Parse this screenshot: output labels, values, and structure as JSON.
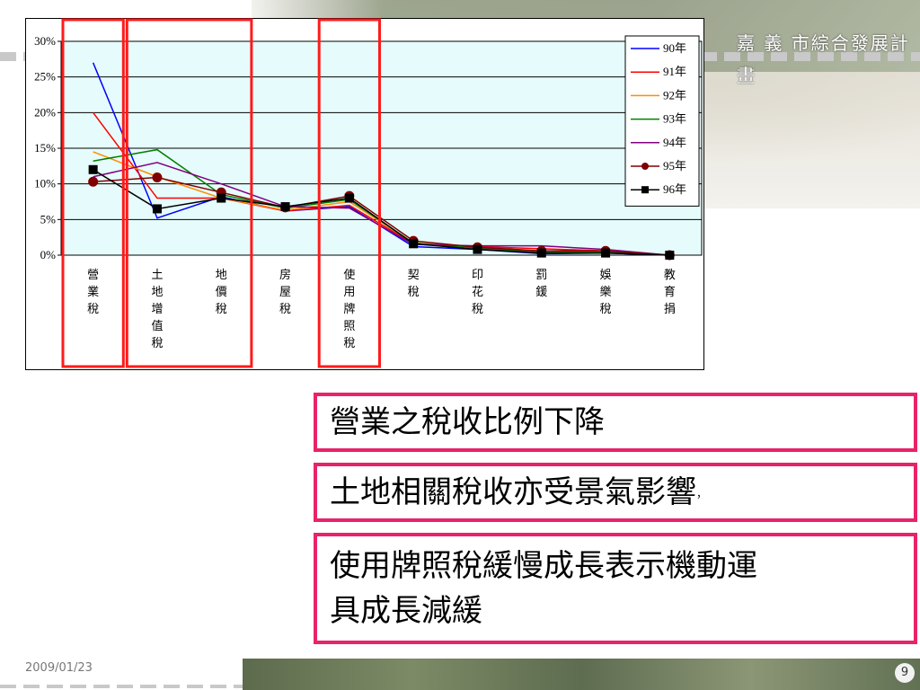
{
  "brand": {
    "title": "嘉 義 市綜合發展計畫"
  },
  "footer": {
    "date": "2009/01/23",
    "page": "9"
  },
  "callouts": {
    "c1": "營業之稅收比例下降",
    "c2": "土地相關稅收亦受景氣影響",
    "c2_tail": "，",
    "c3_line1": "使用牌照稅緩慢成長表示機動運",
    "c3_line2": "具成長減緩"
  },
  "colors": {
    "highlight": "#ff1a1a",
    "callout_border": "#e8236a",
    "plot_bg": "#e6fbfb"
  },
  "chart_data": {
    "type": "line",
    "categories": [
      [
        "營",
        "業",
        "稅"
      ],
      [
        "土",
        "地",
        "增",
        "值",
        "稅"
      ],
      [
        "地",
        "價",
        "稅"
      ],
      [
        "房",
        "屋",
        "稅"
      ],
      [
        "使",
        "用",
        "牌",
        "照",
        "稅"
      ],
      [
        "契",
        "稅"
      ],
      [
        "印",
        "花",
        "稅"
      ],
      [
        "罰",
        "鍰"
      ],
      [
        "娛",
        "樂",
        "稅"
      ],
      [
        "教",
        "育",
        "捐"
      ]
    ],
    "y_ticks": [
      "0%",
      "5%",
      "10%",
      "15%",
      "20%",
      "25%",
      "30%"
    ],
    "ylim": [
      0,
      30
    ],
    "grid": true,
    "legend_position": "top-right",
    "series": [
      {
        "name": "90年",
        "color": "#0000ff",
        "marker": "none",
        "values": [
          27,
          5.2,
          8.2,
          6.2,
          6.8,
          1.2,
          0.8,
          0.2,
          0.3,
          0
        ]
      },
      {
        "name": "91年",
        "color": "#ff0000",
        "marker": "none",
        "values": [
          20,
          8,
          8,
          6.2,
          7,
          1.6,
          1.2,
          0.9,
          0.6,
          0
        ]
      },
      {
        "name": "92年",
        "color": "#ff8c00",
        "marker": "none",
        "values": [
          14.5,
          11,
          8,
          6.3,
          7.5,
          1.7,
          1.1,
          0.5,
          0.5,
          0
        ]
      },
      {
        "name": "93年",
        "color": "#008000",
        "marker": "none",
        "values": [
          13.2,
          14.8,
          8.5,
          6.6,
          7.8,
          1.7,
          1,
          0.4,
          0.4,
          0
        ]
      },
      {
        "name": "94年",
        "color": "#800080",
        "marker": "none",
        "values": [
          11,
          13,
          10,
          6.8,
          6.6,
          1.5,
          1.3,
          1.3,
          0.8,
          0
        ]
      },
      {
        "name": "95年",
        "color": "#800000",
        "marker": "circle",
        "values": [
          10.3,
          10.9,
          8.8,
          6.7,
          8.3,
          2,
          1.1,
          0.6,
          0.6,
          0
        ]
      },
      {
        "name": "96年",
        "color": "#000000",
        "marker": "square",
        "values": [
          12,
          6.5,
          8,
          6.8,
          8,
          1.6,
          0.8,
          0.3,
          0.3,
          0
        ]
      }
    ],
    "highlight_groups": [
      [
        0,
        0
      ],
      [
        1,
        2
      ],
      [
        4,
        4
      ]
    ]
  }
}
